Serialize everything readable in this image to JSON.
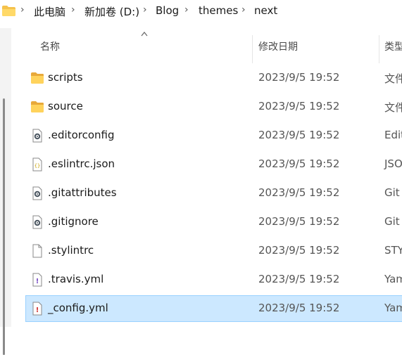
{
  "breadcrumb": {
    "items": [
      "此电脑",
      "新加卷 (D:)",
      "Blog",
      "themes",
      "next"
    ]
  },
  "columns": {
    "name": "名称",
    "modified": "修改日期",
    "type": "类型"
  },
  "files": [
    {
      "name": "scripts",
      "modified": "2023/9/5 19:52",
      "type": "文件",
      "icon": "folder-icon"
    },
    {
      "name": "source",
      "modified": "2023/9/5 19:52",
      "type": "文件",
      "icon": "folder-icon"
    },
    {
      "name": ".editorconfig",
      "modified": "2023/9/5 19:52",
      "type": "Edit",
      "icon": "config-file-icon"
    },
    {
      "name": ".eslintrc.json",
      "modified": "2023/9/5 19:52",
      "type": "JSO",
      "icon": "json-file-icon"
    },
    {
      "name": ".gitattributes",
      "modified": "2023/9/5 19:52",
      "type": "Git",
      "icon": "config-file-icon"
    },
    {
      "name": ".gitignore",
      "modified": "2023/9/5 19:52",
      "type": "Git",
      "icon": "config-file-icon"
    },
    {
      "name": ".stylintrc",
      "modified": "2023/9/5 19:52",
      "type": "STY",
      "icon": "blank-file-icon"
    },
    {
      "name": ".travis.yml",
      "modified": "2023/9/5 19:52",
      "type": "Yam",
      "icon": "yaml-file-icon"
    },
    {
      "name": "_config.yml",
      "modified": "2023/9/5 19:52",
      "type": "Yam",
      "icon": "yaml-file-icon",
      "selected": true
    }
  ],
  "colors": {
    "selection": "#cce8ff",
    "selection_border": "#99d1ff",
    "folder": "#f5c24c"
  }
}
